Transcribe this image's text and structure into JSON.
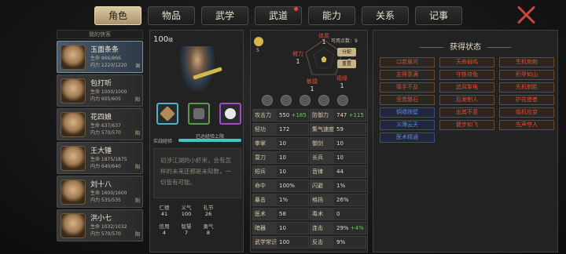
{
  "tabs": [
    {
      "label": "角色",
      "active": true
    },
    {
      "label": "物品"
    },
    {
      "label": "武学"
    },
    {
      "label": "武道",
      "badge": true
    },
    {
      "label": "能力"
    },
    {
      "label": "关系"
    },
    {
      "label": "记事"
    }
  ],
  "left": {
    "header": "我的侠客",
    "cards": [
      {
        "name": "玉面条条",
        "hp": "生命 866/866",
        "mp": "内力 1220/1220",
        "tag": "调"
      },
      {
        "name": "包打听",
        "hp": "生命 1000/1000",
        "mp": "内力 605/605",
        "tag": "阳"
      },
      {
        "name": "花四娘",
        "hp": "生命 637/637",
        "mp": "内力 570/570",
        "tag": "阳"
      },
      {
        "name": "王大锤",
        "hp": "生命 1875/1875",
        "mp": "内力 640/640",
        "tag": "阳"
      },
      {
        "name": "刘十八",
        "hp": "生命 1600/1600",
        "mp": "内力 535/535",
        "tag": "阳"
      },
      {
        "name": "洪小七",
        "hp": "生命 1032/1032",
        "mp": "内力 570/570",
        "tag": "阳"
      }
    ]
  },
  "mid": {
    "level": "100",
    "level_unit": "级",
    "exp_left": "实战经验",
    "exp_right": "已达经验上限",
    "exp_fill": 1.0,
    "bio": "初涉江湖的小虾米，会有怎样的未来还都是未知数，一切皆有可能。",
    "virtues": [
      {
        "name": "仁德",
        "val": "41"
      },
      {
        "name": "义气",
        "val": "100"
      },
      {
        "name": "礼节",
        "val": "26"
      },
      {
        "name": "",
        "val": ""
      },
      {
        "name": "信用",
        "val": "4"
      },
      {
        "name": "智慧",
        "val": "7"
      },
      {
        "name": "勇气",
        "val": "8"
      },
      {
        "name": "",
        "val": ""
      }
    ]
  },
  "attr": {
    "eye_count": "5",
    "free_label": "可用点数：",
    "free_val": "9",
    "btn_assign": "分配",
    "btn_reset": "重置",
    "radar": [
      {
        "name": "体质",
        "val": "1"
      },
      {
        "name": "悟性",
        "val": "1"
      },
      {
        "name": "福缘",
        "val": "1"
      },
      {
        "name": "敏捷",
        "val": "1"
      },
      {
        "name": "臂力",
        "val": "1"
      }
    ],
    "stats": [
      [
        {
          "n": "攻击力",
          "v": "550",
          "g": "+185"
        },
        {
          "n": "防御力",
          "v": "747",
          "g": "+115"
        }
      ],
      [
        {
          "n": "轻功",
          "v": "172"
        },
        {
          "n": "集气速度",
          "v": "59"
        }
      ],
      [
        {
          "n": "拳掌",
          "v": "10"
        },
        {
          "n": "御剑",
          "v": "10"
        }
      ],
      [
        {
          "n": "耍刀",
          "v": "10"
        },
        {
          "n": "长兵",
          "v": "10"
        }
      ],
      [
        {
          "n": "短兵",
          "v": "10"
        },
        {
          "n": "音律",
          "v": "44"
        }
      ],
      [
        {
          "n": "命中",
          "v": "100%"
        },
        {
          "n": "闪避",
          "v": "1%"
        }
      ],
      [
        {
          "n": "暴击",
          "v": "1%"
        },
        {
          "n": "格挡",
          "v": "26%"
        }
      ],
      [
        {
          "n": "医术",
          "v": "58"
        },
        {
          "n": "毒术",
          "v": "0"
        }
      ],
      [
        {
          "n": "暗器",
          "v": "10"
        },
        {
          "n": "连击",
          "v": "29%",
          "g": "+4%"
        }
      ],
      [
        {
          "n": "武学常识",
          "v": "100"
        },
        {
          "n": "反击",
          "v": "9%"
        }
      ]
    ]
  },
  "states": {
    "title": "获得状态",
    "items": [
      {
        "t": "口若悬河"
      },
      {
        "t": "天命弱鸡"
      },
      {
        "t": "生机勃勃"
      },
      {
        "t": "志得意满"
      },
      {
        "t": "守株待兔"
      },
      {
        "t": "积甲如山"
      },
      {
        "t": "猜手不及"
      },
      {
        "t": "追风掣电"
      },
      {
        "t": "先机制胜"
      },
      {
        "t": "坚若磐石"
      },
      {
        "t": "后发制人"
      },
      {
        "t": "护花使者"
      },
      {
        "t": "铜墙铁壁",
        "b": true
      },
      {
        "t": "出其不意"
      },
      {
        "t": "临机应变"
      },
      {
        "t": "义薄云天",
        "b": true
      },
      {
        "t": "健步如飞"
      },
      {
        "t": "先声夺人"
      },
      {
        "t": "医术精通",
        "b": true
      }
    ]
  }
}
